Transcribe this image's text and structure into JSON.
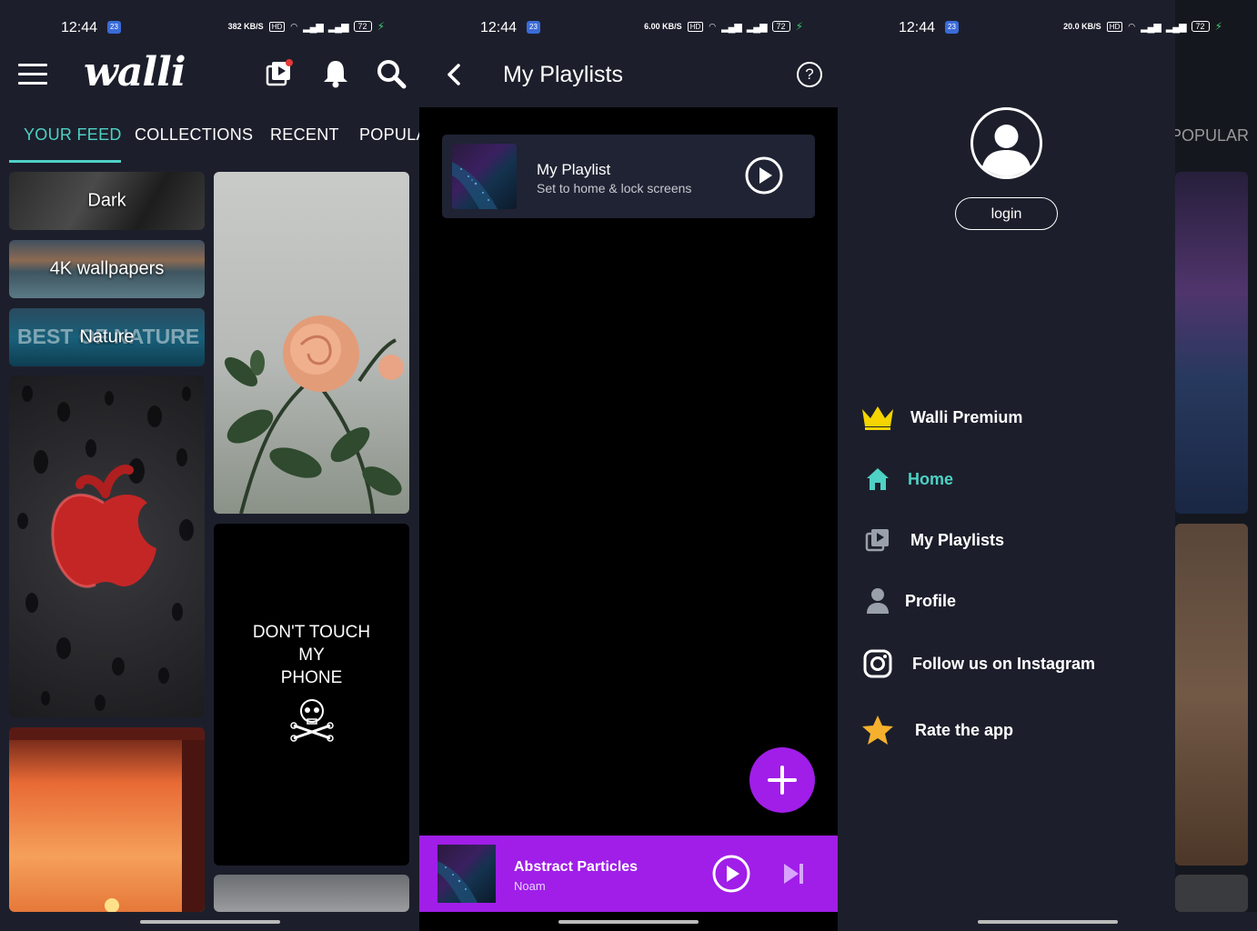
{
  "status": {
    "time": "12:44",
    "badge": "23",
    "speeds": [
      "382 KB/S",
      "6.00 KB/S",
      "20.0 KB/S"
    ],
    "hd": "HD",
    "network": "5G",
    "battery": "72"
  },
  "feed": {
    "logo": "walli",
    "tabs": [
      "YOUR FEED",
      "COLLECTIONS",
      "RECENT",
      "POPULA"
    ],
    "tiles": {
      "dark": "Dark",
      "fourk": "4K wallpapers",
      "nature": "Nature",
      "nature_bg_text": "BEST OF NATURE",
      "phone_text_1": "DON'T TOUCH",
      "phone_text_2": "MY",
      "phone_text_3": "PHONE"
    }
  },
  "playlists": {
    "title": "My Playlists",
    "help": "?",
    "item": {
      "name": "My Playlist",
      "subtitle": "Set to home & lock screens"
    },
    "player": {
      "title": "Abstract Particles",
      "artist": "Noam"
    }
  },
  "drawer": {
    "login": "login",
    "popular_partial": "POPULAR",
    "items": [
      {
        "label": "Walli Premium",
        "color": "#ffffff"
      },
      {
        "label": "Home",
        "color": "#4fd1c5"
      },
      {
        "label": "My Playlists",
        "color": "#ffffff"
      },
      {
        "label": "Profile",
        "color": "#ffffff"
      },
      {
        "label": "Follow us on Instagram",
        "color": "#ffffff"
      },
      {
        "label": "Rate the app",
        "color": "#ffffff"
      }
    ]
  },
  "colors": {
    "accent_teal": "#4fd1c5",
    "accent_purple": "#a01ee8",
    "panel_bg": "#1c1f2b",
    "premium_yellow": "#f5d400",
    "rate_star": "#f5b02e"
  }
}
